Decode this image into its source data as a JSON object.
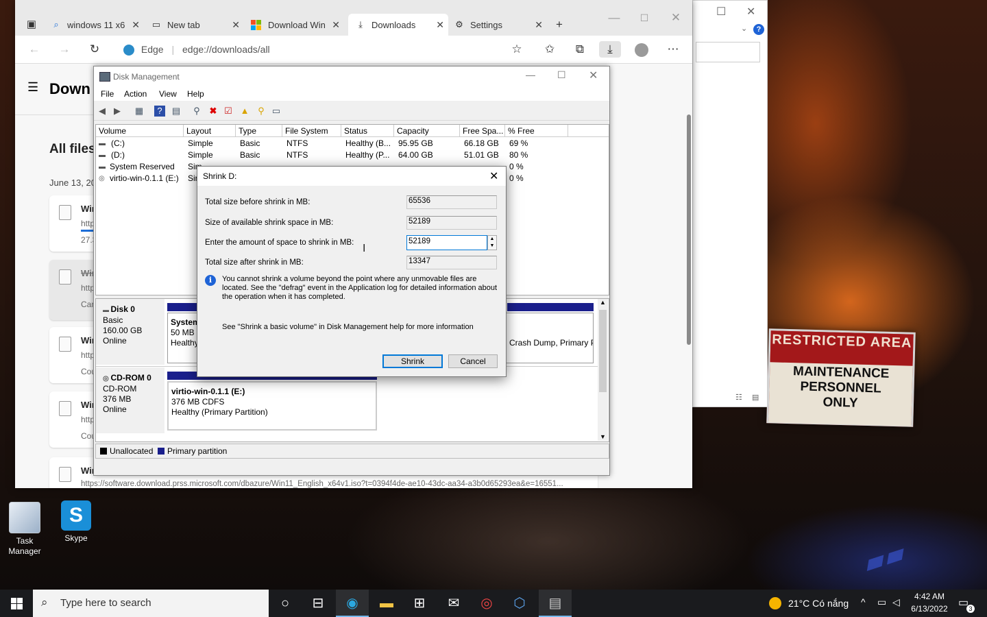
{
  "wallpaper": {
    "sign_top": "RESTRICTED AREA",
    "sign_lines": [
      "MAINTENANCE",
      "PERSONNEL",
      "ONLY"
    ]
  },
  "edge": {
    "tabs": [
      {
        "label": "windows 11 x6",
        "icon": "search-icon"
      },
      {
        "label": "New tab",
        "icon": "newtab-icon"
      },
      {
        "label": "Download Win",
        "icon": "windows-logo-icon"
      },
      {
        "label": "Downloads",
        "icon": "download-icon",
        "active": true
      },
      {
        "label": "Settings",
        "icon": "gear-icon"
      }
    ],
    "address_prefix": "Edge",
    "address": "edge://downloads/all",
    "page_title": "Down",
    "section_title": "All files",
    "date_label": "June 13, 20",
    "downloads": [
      {
        "title": "Win",
        "url": "http",
        "status": "27.3"
      },
      {
        "title": "Win",
        "url": "http",
        "status": "Can"
      },
      {
        "title": "Win",
        "url": "http",
        "status": "Cou"
      },
      {
        "title": "Win",
        "url": "http",
        "status": "Cou"
      },
      {
        "title": "Win",
        "url": "https://software.download.prss.microsoft.com/dbazure/Win11_English_x64v1.iso?t=0394f4de-ae10-43dc-aa34-a3b0d65293ea&e=16551..."
      }
    ]
  },
  "diskmgmt": {
    "title": "Disk Management",
    "menu": [
      "File",
      "Action",
      "View",
      "Help"
    ],
    "columns": [
      "Volume",
      "Layout",
      "Type",
      "File System",
      "Status",
      "Capacity",
      "Free Spa...",
      "% Free"
    ],
    "rows": [
      {
        "volume": "(C:)",
        "layout": "Simple",
        "type": "Basic",
        "fs": "NTFS",
        "status": "Healthy (B...",
        "capacity": "95.95 GB",
        "free": "66.18 GB",
        "pct": "69 %"
      },
      {
        "volume": "(D:)",
        "layout": "Simple",
        "type": "Basic",
        "fs": "NTFS",
        "status": "Healthy (P...",
        "capacity": "64.00 GB",
        "free": "51.01 GB",
        "pct": "80 %"
      },
      {
        "volume": "System Reserved",
        "layout": "Sim",
        "type": "",
        "fs": "",
        "status": "",
        "capacity": "",
        "free": "",
        "pct": "0 %"
      },
      {
        "volume": "virtio-win-0.1.1 (E:)",
        "layout": "Sir",
        "type": "",
        "fs": "",
        "status": "",
        "capacity": "",
        "free": "",
        "pct": "0 %"
      }
    ],
    "disk0": {
      "name": "Disk 0",
      "type": "Basic",
      "size": "160.00 GB",
      "state": "Online",
      "part1_name": "System",
      "part1_size": "50 MB",
      "part1_status": "Healthy",
      "part3_status": "Crash Dump, Primary P"
    },
    "cdrom0": {
      "name": "CD-ROM 0",
      "type": "CD-ROM",
      "size": "376 MB",
      "state": "Online",
      "part_name": "virtio-win-0.1.1  (E:)",
      "part_size": "376 MB CDFS",
      "part_status": "Healthy (Primary Partition)"
    },
    "legend": [
      "Unallocated",
      "Primary partition"
    ]
  },
  "shrink": {
    "title": "Shrink D:",
    "total_before_label": "Total size before shrink in MB:",
    "total_before": "65536",
    "available_label": "Size of available shrink space in MB:",
    "available": "52189",
    "amount_label": "Enter the amount of space to shrink in MB:",
    "amount": "52189",
    "total_after_label": "Total size after shrink in MB:",
    "total_after": "13347",
    "info": "You cannot shrink a volume beyond the point where any unmovable files are located. See the \"defrag\" event in the Application log for detailed information about the operation when it has completed.",
    "help_text": "See \"Shrink a basic volume\" in Disk Management help for more information",
    "shrink_button": "Shrink",
    "cancel_button": "Cancel"
  },
  "desktop": {
    "icons": [
      {
        "label": "Task Manager"
      },
      {
        "label": "Skype"
      }
    ]
  },
  "taskbar": {
    "search_placeholder": "Type here to search",
    "weather": "21°C  Có nắng",
    "time": "4:42 AM",
    "date": "6/13/2022",
    "notifications": "3"
  }
}
